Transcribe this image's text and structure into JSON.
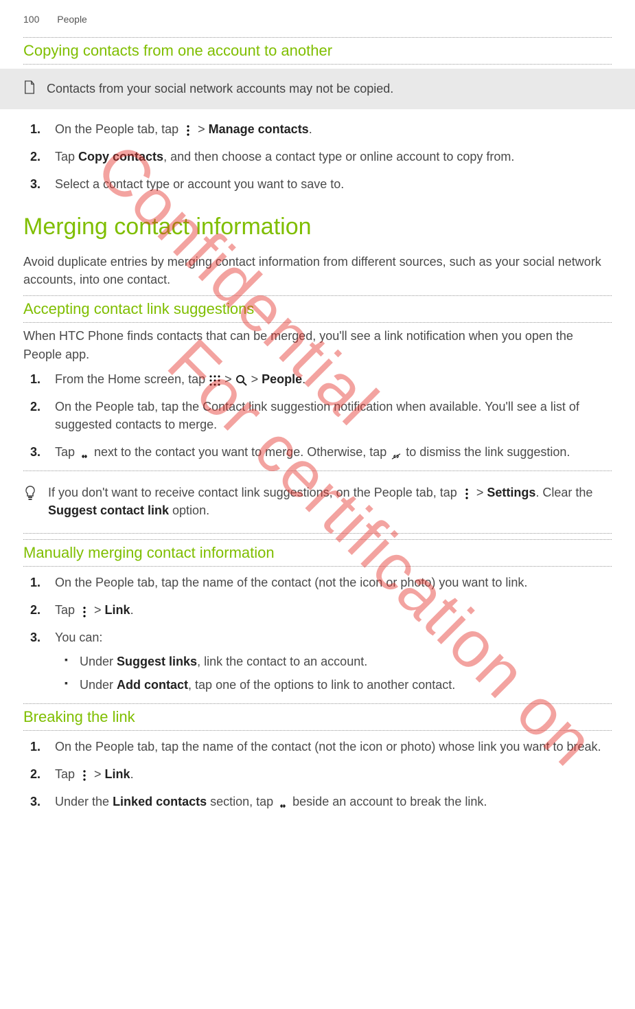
{
  "header": {
    "page_number": "100",
    "section": "People"
  },
  "watermarks": {
    "wm1": "Confidential",
    "wm2": "For certification on"
  },
  "s1": {
    "title": "Copying contacts from one account to another",
    "note": "Contacts from your social network accounts may not be copied.",
    "steps": {
      "0a": "On the People tab, tap ",
      "0b": " > ",
      "0c": "Manage contacts",
      "0d": ".",
      "1a": "Tap ",
      "1b": "Copy contacts",
      "1c": ", and then choose a contact type or online account to copy from.",
      "2": "Select a contact type or account you want to save to."
    }
  },
  "s2": {
    "title": "Merging contact information",
    "intro": "Avoid duplicate entries by merging contact information from different sources, such as your social network accounts, into one contact."
  },
  "s3": {
    "title": "Accepting contact link suggestions",
    "intro": "When HTC Phone finds contacts that can be merged, you'll see a link notification when you open the People app.",
    "steps": {
      "0a": "From the Home screen, tap ",
      "0b": " > ",
      "0c": " > ",
      "0d": "People",
      "0e": ".",
      "1": "On the People tab, tap the Contact link suggestion notification when available. You'll see a list of suggested contacts to merge.",
      "2a": "Tap ",
      "2b": " next to the contact you want to merge. Otherwise, tap ",
      "2c": " to dismiss the link suggestion."
    },
    "tip_a": "If you don't want to receive contact link suggestions, on the People tab, tap ",
    "tip_b": " > ",
    "tip_c": "Settings",
    "tip_d": ". Clear the ",
    "tip_e": "Suggest contact link",
    "tip_f": " option."
  },
  "s4": {
    "title": "Manually merging contact information",
    "steps": {
      "0": "On the People tab, tap the name of the contact (not the icon or photo) you want to link.",
      "1a": "Tap ",
      "1b": " > ",
      "1c": "Link",
      "1d": ".",
      "2": "You can:"
    },
    "bullets": {
      "0a": "Under ",
      "0b": "Suggest links",
      "0c": ", link the contact to an account.",
      "1a": "Under ",
      "1b": "Add contact",
      "1c": ", tap one of the options to link to another contact."
    }
  },
  "s5": {
    "title": "Breaking the link",
    "steps": {
      "0": "On the People tab, tap the name of the contact (not the icon or photo) whose link you want to break.",
      "1a": "Tap ",
      "1b": " > ",
      "1c": "Link",
      "1d": ".",
      "2a": "Under the ",
      "2b": "Linked contacts",
      "2c": " section, tap ",
      "2d": " beside an account to break the link."
    }
  }
}
